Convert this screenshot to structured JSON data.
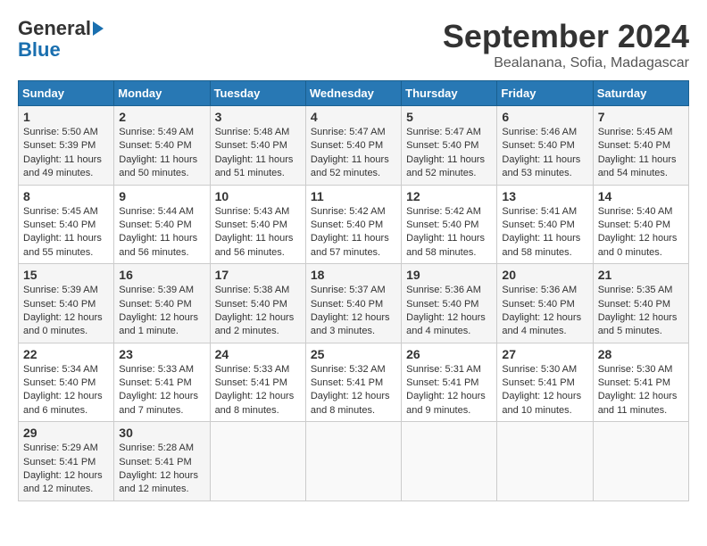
{
  "header": {
    "logo_line1": "General",
    "logo_line2": "Blue",
    "month_title": "September 2024",
    "location": "Bealanana, Sofia, Madagascar"
  },
  "weekdays": [
    "Sunday",
    "Monday",
    "Tuesday",
    "Wednesday",
    "Thursday",
    "Friday",
    "Saturday"
  ],
  "weeks": [
    [
      {
        "day": "1",
        "sunrise": "5:50 AM",
        "sunset": "5:39 PM",
        "daylight": "11 hours and 49 minutes."
      },
      {
        "day": "2",
        "sunrise": "5:49 AM",
        "sunset": "5:40 PM",
        "daylight": "11 hours and 50 minutes."
      },
      {
        "day": "3",
        "sunrise": "5:48 AM",
        "sunset": "5:40 PM",
        "daylight": "11 hours and 51 minutes."
      },
      {
        "day": "4",
        "sunrise": "5:47 AM",
        "sunset": "5:40 PM",
        "daylight": "11 hours and 52 minutes."
      },
      {
        "day": "5",
        "sunrise": "5:47 AM",
        "sunset": "5:40 PM",
        "daylight": "11 hours and 52 minutes."
      },
      {
        "day": "6",
        "sunrise": "5:46 AM",
        "sunset": "5:40 PM",
        "daylight": "11 hours and 53 minutes."
      },
      {
        "day": "7",
        "sunrise": "5:45 AM",
        "sunset": "5:40 PM",
        "daylight": "11 hours and 54 minutes."
      }
    ],
    [
      {
        "day": "8",
        "sunrise": "5:45 AM",
        "sunset": "5:40 PM",
        "daylight": "11 hours and 55 minutes."
      },
      {
        "day": "9",
        "sunrise": "5:44 AM",
        "sunset": "5:40 PM",
        "daylight": "11 hours and 56 minutes."
      },
      {
        "day": "10",
        "sunrise": "5:43 AM",
        "sunset": "5:40 PM",
        "daylight": "11 hours and 56 minutes."
      },
      {
        "day": "11",
        "sunrise": "5:42 AM",
        "sunset": "5:40 PM",
        "daylight": "11 hours and 57 minutes."
      },
      {
        "day": "12",
        "sunrise": "5:42 AM",
        "sunset": "5:40 PM",
        "daylight": "11 hours and 58 minutes."
      },
      {
        "day": "13",
        "sunrise": "5:41 AM",
        "sunset": "5:40 PM",
        "daylight": "11 hours and 58 minutes."
      },
      {
        "day": "14",
        "sunrise": "5:40 AM",
        "sunset": "5:40 PM",
        "daylight": "12 hours and 0 minutes."
      }
    ],
    [
      {
        "day": "15",
        "sunrise": "5:39 AM",
        "sunset": "5:40 PM",
        "daylight": "12 hours and 0 minutes."
      },
      {
        "day": "16",
        "sunrise": "5:39 AM",
        "sunset": "5:40 PM",
        "daylight": "12 hours and 1 minute."
      },
      {
        "day": "17",
        "sunrise": "5:38 AM",
        "sunset": "5:40 PM",
        "daylight": "12 hours and 2 minutes."
      },
      {
        "day": "18",
        "sunrise": "5:37 AM",
        "sunset": "5:40 PM",
        "daylight": "12 hours and 3 minutes."
      },
      {
        "day": "19",
        "sunrise": "5:36 AM",
        "sunset": "5:40 PM",
        "daylight": "12 hours and 4 minutes."
      },
      {
        "day": "20",
        "sunrise": "5:36 AM",
        "sunset": "5:40 PM",
        "daylight": "12 hours and 4 minutes."
      },
      {
        "day": "21",
        "sunrise": "5:35 AM",
        "sunset": "5:40 PM",
        "daylight": "12 hours and 5 minutes."
      }
    ],
    [
      {
        "day": "22",
        "sunrise": "5:34 AM",
        "sunset": "5:40 PM",
        "daylight": "12 hours and 6 minutes."
      },
      {
        "day": "23",
        "sunrise": "5:33 AM",
        "sunset": "5:41 PM",
        "daylight": "12 hours and 7 minutes."
      },
      {
        "day": "24",
        "sunrise": "5:33 AM",
        "sunset": "5:41 PM",
        "daylight": "12 hours and 8 minutes."
      },
      {
        "day": "25",
        "sunrise": "5:32 AM",
        "sunset": "5:41 PM",
        "daylight": "12 hours and 8 minutes."
      },
      {
        "day": "26",
        "sunrise": "5:31 AM",
        "sunset": "5:41 PM",
        "daylight": "12 hours and 9 minutes."
      },
      {
        "day": "27",
        "sunrise": "5:30 AM",
        "sunset": "5:41 PM",
        "daylight": "12 hours and 10 minutes."
      },
      {
        "day": "28",
        "sunrise": "5:30 AM",
        "sunset": "5:41 PM",
        "daylight": "12 hours and 11 minutes."
      }
    ],
    [
      {
        "day": "29",
        "sunrise": "5:29 AM",
        "sunset": "5:41 PM",
        "daylight": "12 hours and 12 minutes."
      },
      {
        "day": "30",
        "sunrise": "5:28 AM",
        "sunset": "5:41 PM",
        "daylight": "12 hours and 12 minutes."
      },
      null,
      null,
      null,
      null,
      null
    ]
  ]
}
